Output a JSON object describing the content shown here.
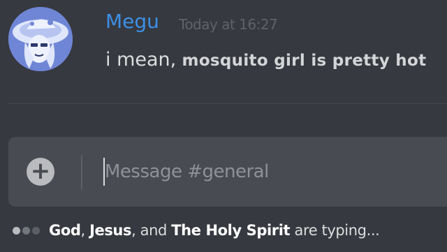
{
  "colors": {
    "background": "#36393f",
    "username": "#3d8fe6",
    "composer": "#484b51",
    "avatar": "#6f86d6"
  },
  "message": {
    "author": "Megu",
    "timestamp": "Today at 16:27",
    "text_part1": "i mean,",
    "text_part2": " mosquito girl is pretty hot",
    "avatar_icon": "avatar-image"
  },
  "composer": {
    "add_icon": "plus-circle-icon",
    "placeholder": "Message #general"
  },
  "typing": {
    "user1": "God",
    "sep1": ", ",
    "user2": "Jesus",
    "sep2": ", and ",
    "user3": "The Holy Spirit",
    "suffix": " are typing..."
  }
}
